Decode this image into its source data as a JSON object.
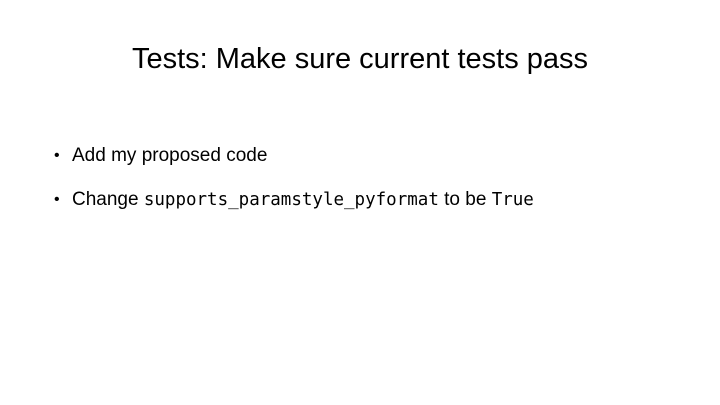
{
  "slide": {
    "title": "Tests: Make sure current tests pass",
    "bullet_marker": "•",
    "bullets": [
      {
        "text": "Add my proposed code"
      },
      {
        "prefix": "Change ",
        "code1": "supports_paramstyle_pyformat",
        "middle": " to be ",
        "code2": "True"
      }
    ]
  }
}
